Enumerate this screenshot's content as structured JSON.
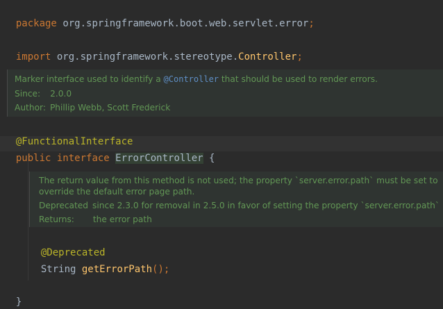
{
  "code": {
    "package_kw": "package",
    "package_name": "org.springframework.boot.web.servlet.error",
    "import_kw": "import",
    "import_pkg": "org.springframework.stereotype.",
    "import_cls": "Controller",
    "semicolon": ";",
    "annotation1": "@FunctionalInterface",
    "public_kw": "public",
    "interface_kw": "interface",
    "interface_name": "ErrorController",
    "open_brace": "{",
    "annotation2": "@Deprecated",
    "return_type": "String",
    "method_name": "getErrorPath",
    "method_suffix": "();",
    "close_brace": "}"
  },
  "doc1": {
    "line1_pre": "Marker interface used to identify a ",
    "line1_ref": "@Controller",
    "line1_post": " that should be used to render errors.",
    "since_label": "Since:",
    "since_value": "2.0.0",
    "author_label": "Author:",
    "author_value": "Phillip Webb, Scott Frederick"
  },
  "doc2": {
    "line1": "The return value from this method is not used; the property `server.error.path` must be set to",
    "line2": "override the default error page path.",
    "deprecated_label": "Deprecated",
    "deprecated_value": "since 2.3.0 for removal in 2.5.0 in favor of setting the property `server.error.path`",
    "returns_label": "Returns:",
    "returns_value": "the error path"
  }
}
